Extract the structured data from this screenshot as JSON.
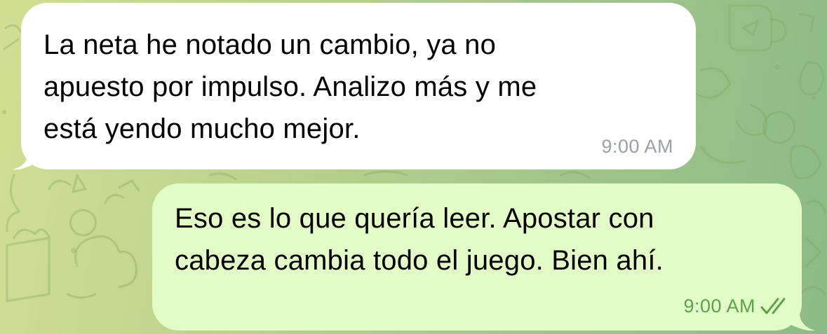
{
  "chat": {
    "messages": [
      {
        "direction": "incoming",
        "text": "La neta he notado un cambio, ya no\napuesto por impulso. Analizo más y me\nestá yendo mucho mejor.",
        "time": "9:00 AM"
      },
      {
        "direction": "outgoing",
        "text": "Eso es lo que quería leer. Apostar con\ncabeza cambia todo el juego. Bien ahí.",
        "time": "9:00 AM",
        "status_icon": "double-check-icon"
      }
    ]
  },
  "colors": {
    "incoming_bubble": "#ffffff",
    "outgoing_bubble": "#e3fbc6",
    "outgoing_meta": "#5aa34b",
    "incoming_meta": "#9aa0a6"
  }
}
